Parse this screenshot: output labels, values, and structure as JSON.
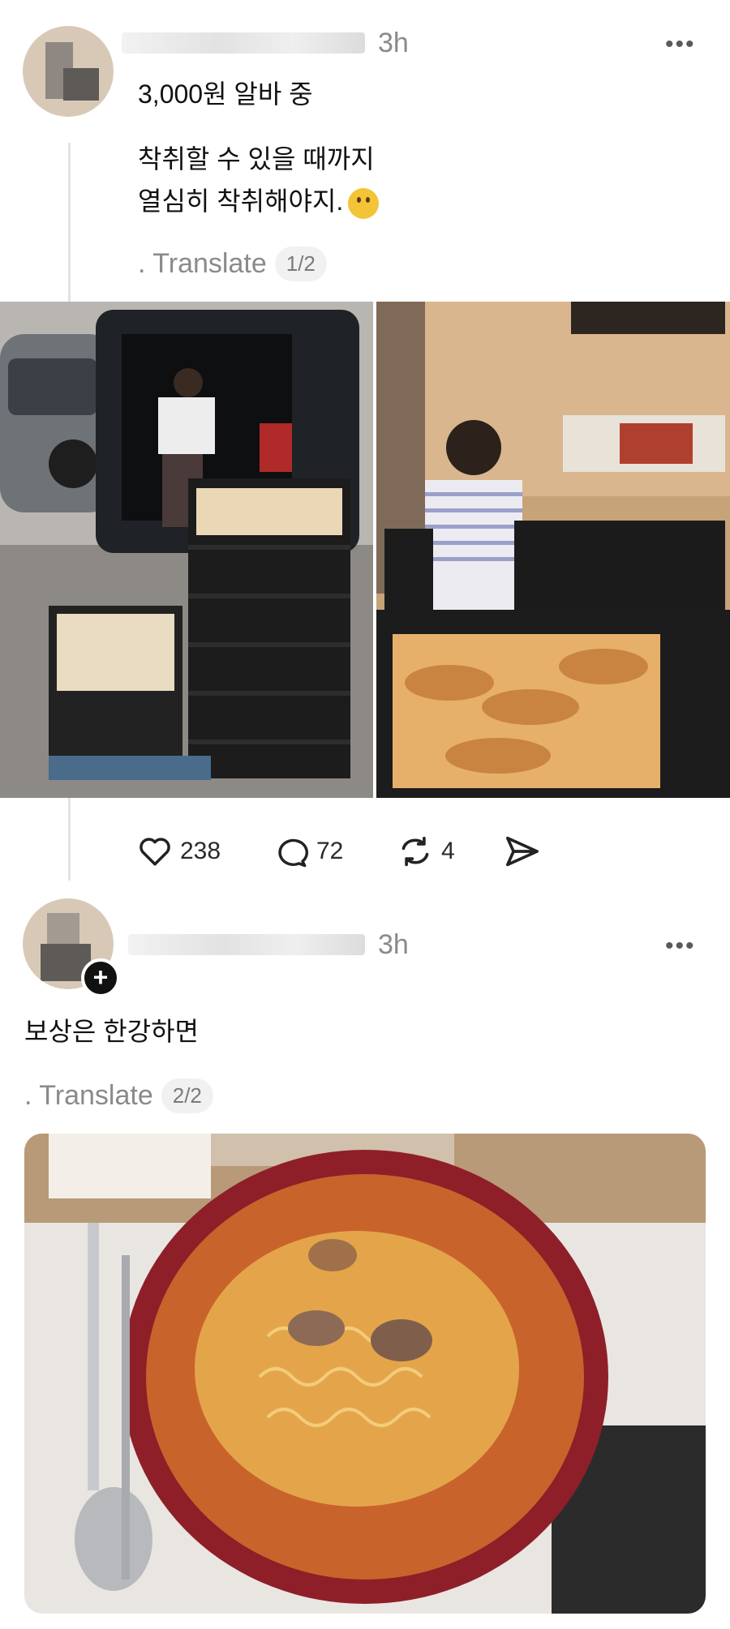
{
  "post1": {
    "time": "3h",
    "more_label": "•••",
    "text_line1": "3,000원 알바 중",
    "text_line2": "착취할 수 있을 때까지",
    "text_line3": "열심히 착취해야지.",
    "translate_label": ". Translate",
    "pager": "1/2",
    "actions": {
      "likes": "238",
      "comments": "72",
      "reposts": "4"
    }
  },
  "post2": {
    "time": "3h",
    "more_label": "•••",
    "text": "보상은 한강하면",
    "translate_label": ". Translate",
    "pager": "2/2"
  },
  "icons": {
    "like": "heart-icon",
    "comment": "comment-bubble-icon",
    "repost": "repost-icon",
    "share": "share-send-icon",
    "more": "more-dots-icon",
    "follow": "plus-icon"
  },
  "colors": {
    "muted_text": "#8a8a8a",
    "thread_line": "#e3e3e3",
    "pager_bg": "#f1f1f1"
  }
}
